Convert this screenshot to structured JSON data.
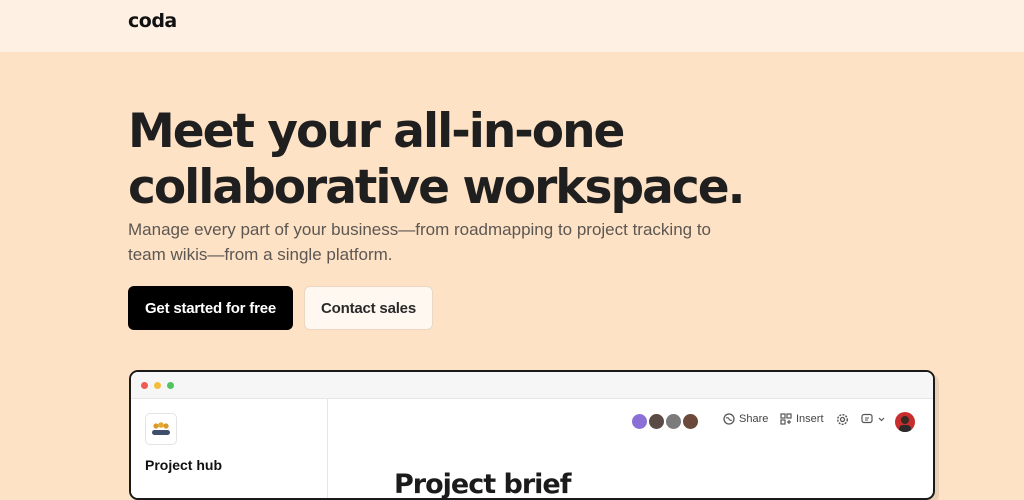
{
  "brand": {
    "logo_text": "coda"
  },
  "hero": {
    "title": "Meet your all-in-one collaborative workspace.",
    "subtitle": "Manage every part of your business—from roadmapping to project tracking to team wikis—from a single platform."
  },
  "cta": {
    "primary_label": "Get started for free",
    "secondary_label": "Contact sales"
  },
  "app_preview": {
    "sidebar": {
      "doc_title": "Project hub",
      "doc_icon": "team-people-icon"
    },
    "toolbar": {
      "share_label": "Share",
      "insert_label": "Insert",
      "collaborator_count": 4
    },
    "document": {
      "heading": "Project brief"
    }
  },
  "colors": {
    "page_background": "#fee2c5",
    "header_background": "#fef0e2",
    "primary_button": "#000000",
    "window_dot_red": "#ee5b52",
    "window_dot_yellow": "#f4be3c",
    "window_dot_green": "#4fc461"
  }
}
